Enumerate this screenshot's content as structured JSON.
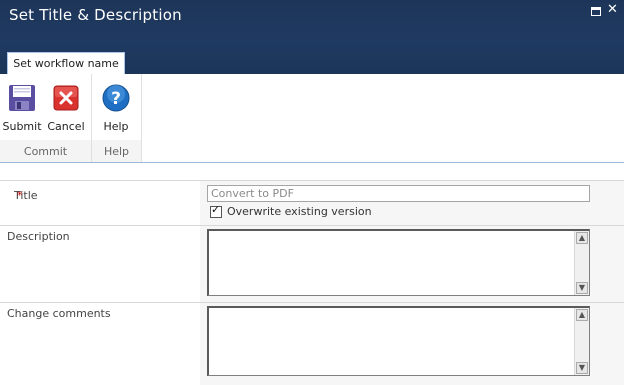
{
  "dialog": {
    "title": "Set Title & Description"
  },
  "ribbon": {
    "tab_label": "Set workflow name",
    "groups": [
      {
        "label": "Commit",
        "buttons": [
          {
            "label": "Submit",
            "icon": "floppy-disk-icon"
          },
          {
            "label": "Cancel",
            "icon": "cancel-x-icon"
          }
        ]
      },
      {
        "label": "Help",
        "buttons": [
          {
            "label": "Help",
            "icon": "help-question-icon"
          }
        ]
      }
    ]
  },
  "form": {
    "title_label": "Title",
    "required_marker": "*",
    "title_value": "Convert to PDF",
    "overwrite_label": "Overwrite existing version",
    "overwrite_checked": true,
    "description_label": "Description",
    "description_value": "",
    "comments_label": "Change comments",
    "comments_value": ""
  },
  "colors": {
    "header_bg": "#1f3a62",
    "required": "#bf0000",
    "accent_blue": "#1e6fc4",
    "cancel_red": "#d9322f"
  }
}
